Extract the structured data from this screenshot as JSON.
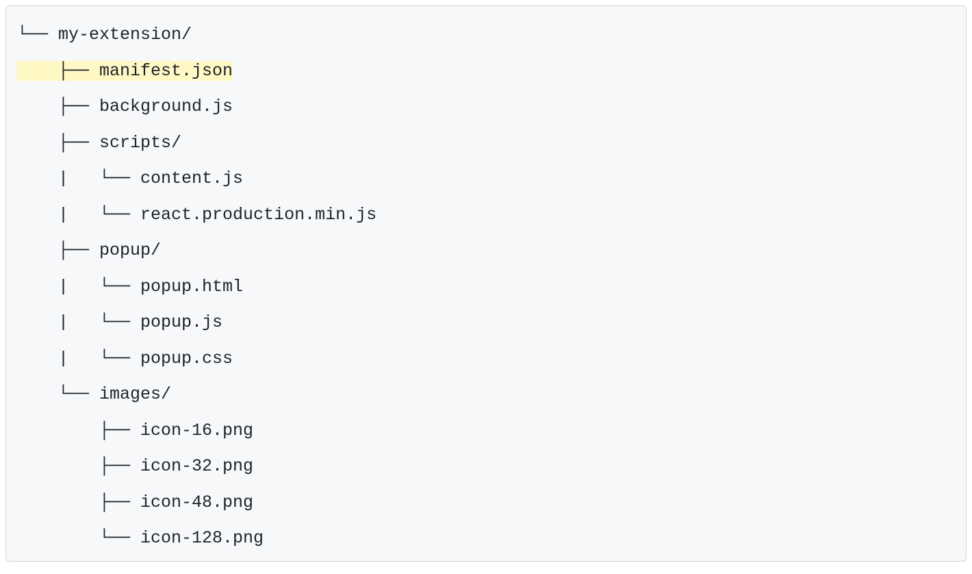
{
  "tree": {
    "lines": [
      {
        "prefix": "└── ",
        "name": "my-extension/",
        "highlight": false
      },
      {
        "prefix": "    ├── ",
        "name": "manifest.json",
        "highlight": true
      },
      {
        "prefix": "    ├── ",
        "name": "background.js",
        "highlight": false
      },
      {
        "prefix": "    ├── ",
        "name": "scripts/",
        "highlight": false
      },
      {
        "prefix": "    |   └── ",
        "name": "content.js",
        "highlight": false
      },
      {
        "prefix": "    |   └── ",
        "name": "react.production.min.js",
        "highlight": false
      },
      {
        "prefix": "    ├── ",
        "name": "popup/",
        "highlight": false
      },
      {
        "prefix": "    |   └── ",
        "name": "popup.html",
        "highlight": false
      },
      {
        "prefix": "    |   └── ",
        "name": "popup.js",
        "highlight": false
      },
      {
        "prefix": "    |   └── ",
        "name": "popup.css",
        "highlight": false
      },
      {
        "prefix": "    └── ",
        "name": "images/",
        "highlight": false
      },
      {
        "prefix": "        ├── ",
        "name": "icon-16.png",
        "highlight": false
      },
      {
        "prefix": "        ├── ",
        "name": "icon-32.png",
        "highlight": false
      },
      {
        "prefix": "        ├── ",
        "name": "icon-48.png",
        "highlight": false
      },
      {
        "prefix": "        └── ",
        "name": "icon-128.png",
        "highlight": false
      }
    ]
  }
}
